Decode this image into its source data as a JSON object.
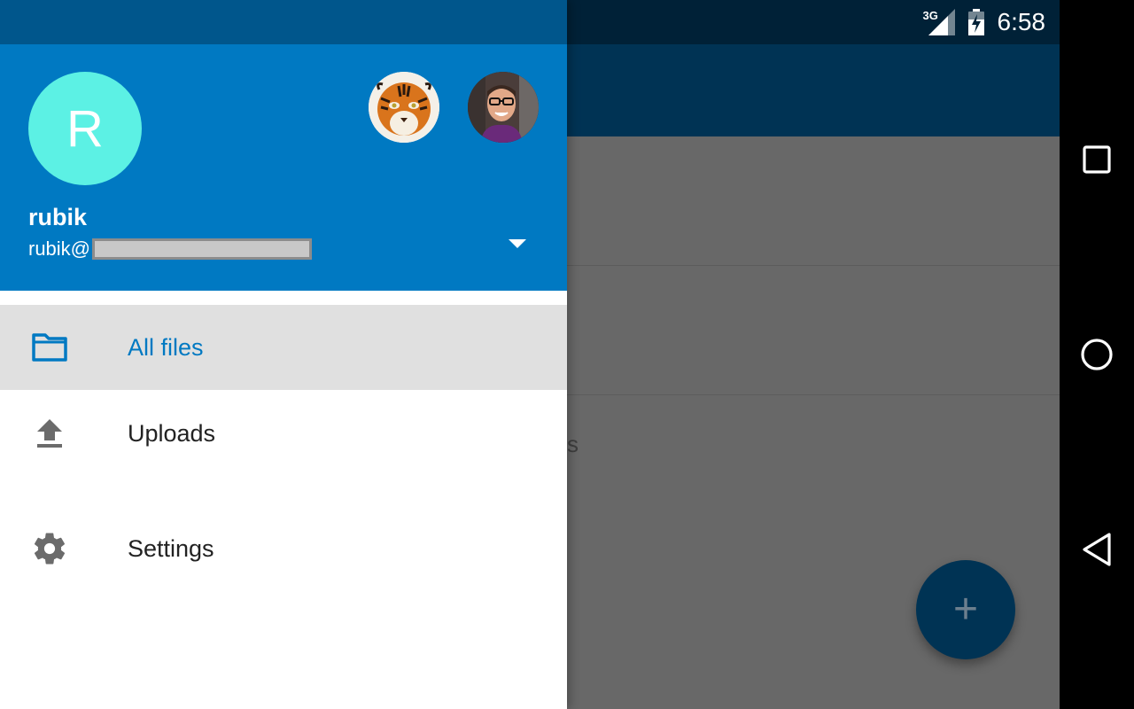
{
  "status_bar": {
    "network": "3G",
    "time": "6:58"
  },
  "background": {
    "partial_text": "s"
  },
  "fab": {
    "label": "+"
  },
  "drawer": {
    "header": {
      "avatar_initial": "R",
      "user_name": "rubik",
      "user_email_prefix": "rubik@",
      "other_accounts": [
        "tiger-avatar",
        "person-avatar"
      ]
    },
    "items": [
      {
        "label": "All files",
        "icon": "folder-icon",
        "selected": true
      },
      {
        "label": "Uploads",
        "icon": "upload-icon",
        "selected": false
      },
      {
        "label": "Settings",
        "icon": "gear-icon",
        "selected": false
      }
    ]
  },
  "colors": {
    "primary": "#0079c2",
    "primary_dark": "#00568c",
    "accent_avatar": "#5cf1e4",
    "toolbar_dimmed": "#003354"
  }
}
